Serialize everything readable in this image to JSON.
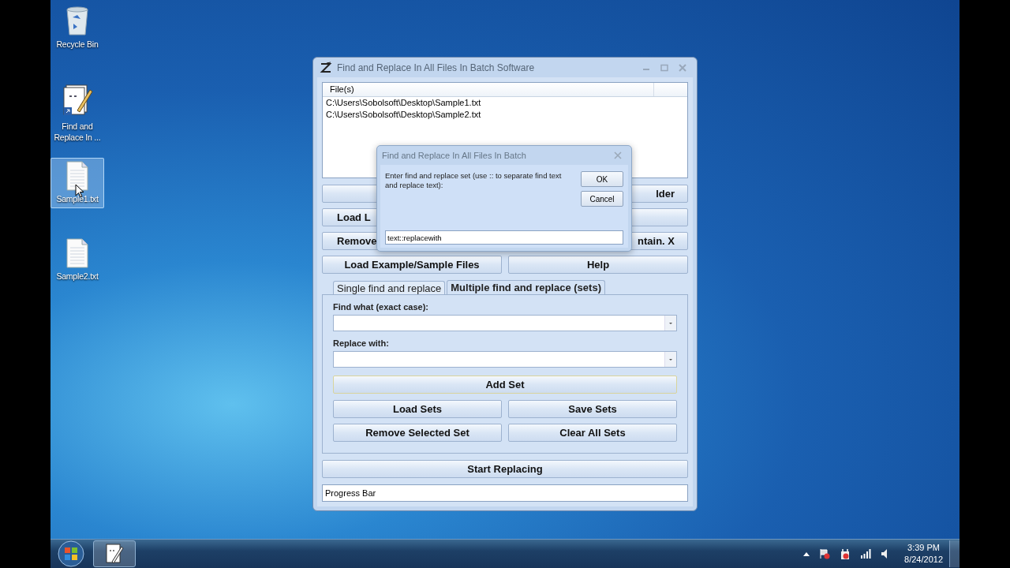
{
  "desktop_icons": [
    {
      "label": "Recycle Bin",
      "kind": "recycle_bin",
      "selected": false
    },
    {
      "label": "Find and Replace In ...",
      "kind": "shortcut",
      "selected": false
    },
    {
      "label": "Sample1.txt",
      "kind": "text_file",
      "selected": true
    },
    {
      "label": "Sample2.txt",
      "kind": "text_file",
      "selected": false
    }
  ],
  "window": {
    "title": "Find and Replace In All Files In Batch Software",
    "file_list": {
      "columns": [
        "File(s)"
      ],
      "rows": [
        "C:\\Users\\Sobolsoft\\Desktop\\Sample1.txt",
        "C:\\Users\\Sobolsoft\\Desktop\\Sample2.txt"
      ]
    },
    "buttons": [
      {
        "kind": "covered"
      },
      {
        "kind": "partial_end",
        "label": "lder"
      },
      {
        "kind": "partial_start",
        "label": "Load L"
      },
      {
        "kind": "covered"
      },
      {
        "kind": "partial_start",
        "label": "Remove"
      },
      {
        "kind": "partial_end",
        "label": "ntain. X"
      },
      {
        "kind": "full",
        "label": "Load Example/Sample Files"
      },
      {
        "kind": "full",
        "label": "Help"
      }
    ],
    "tabs": [
      {
        "label": "Single find and replace",
        "selected": false
      },
      {
        "label": "Multiple find and replace (sets)",
        "selected": true
      }
    ],
    "find_label": "Find what (exact case):",
    "replace_label": "Replace with:",
    "add_button": "Add Set",
    "set_buttons": [
      "Load Sets",
      "Save Sets",
      "Remove Selected Set",
      "Clear All Sets"
    ],
    "start_button": "Start Replacing",
    "progress_bar": "Progress Bar"
  },
  "dialog": {
    "title": "Find and Replace In All Files In Batch",
    "message": "Enter find and replace set (use :: to separate find text and replace text):",
    "ok_button": "OK",
    "cancel_button": "Cancel",
    "input_value": "text::replacewith"
  },
  "taskbar": {
    "time": "3:39 PM",
    "date": "8/24/2012"
  }
}
